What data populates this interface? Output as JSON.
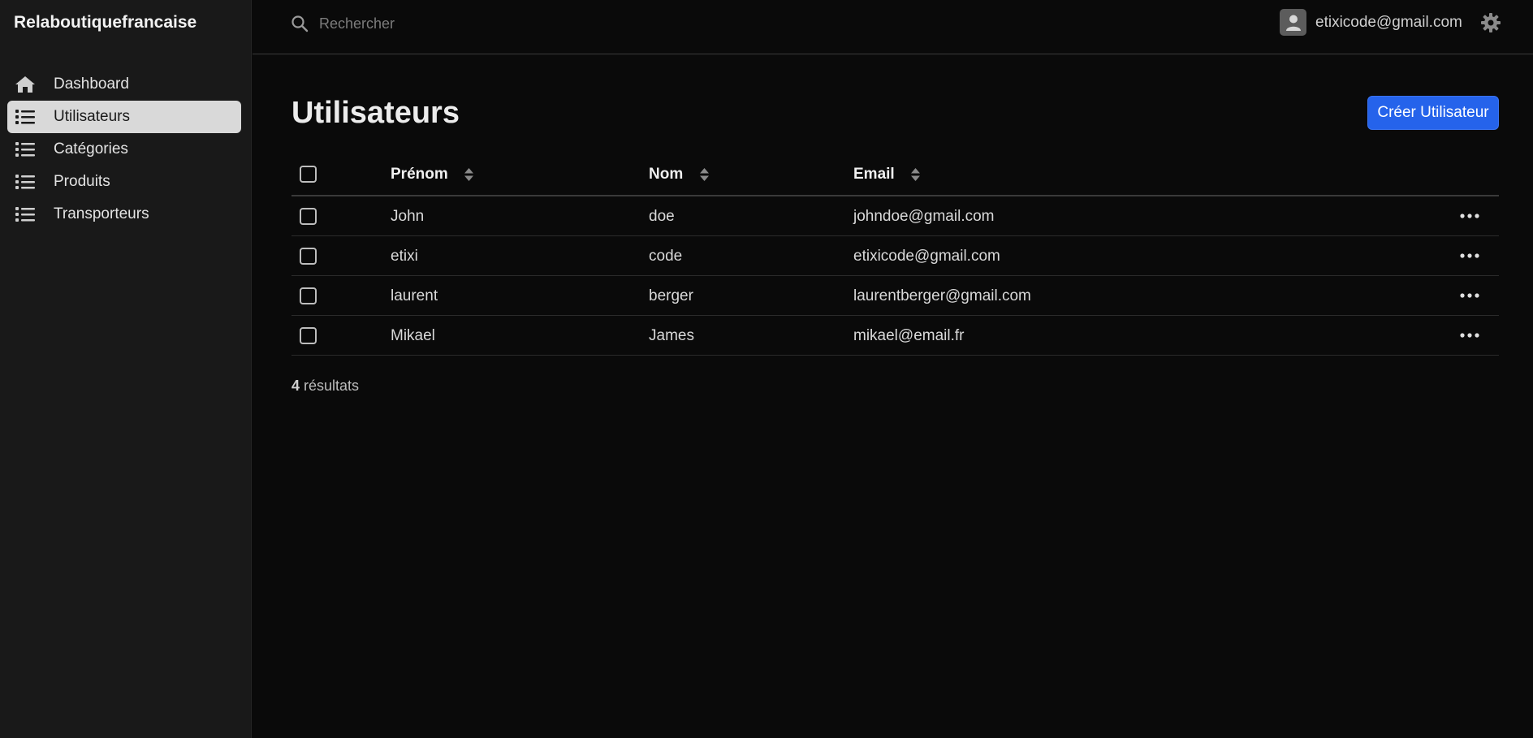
{
  "sidebar": {
    "brand": "Relaboutiquefrancaise",
    "items": [
      {
        "label": "Dashboard",
        "icon": "home-icon",
        "active": false
      },
      {
        "label": "Utilisateurs",
        "icon": "list-icon",
        "active": true
      },
      {
        "label": "Catégories",
        "icon": "list-icon",
        "active": false
      },
      {
        "label": "Produits",
        "icon": "list-icon",
        "active": false
      },
      {
        "label": "Transporteurs",
        "icon": "list-icon",
        "active": false
      }
    ]
  },
  "topbar": {
    "search": {
      "placeholder": "Rechercher",
      "value": ""
    },
    "user_email": "etixicode@gmail.com",
    "icons": [
      "search-icon",
      "avatar-icon",
      "gear-icon"
    ]
  },
  "main": {
    "title": "Utilisateurs",
    "create_button": "Créer Utilisateur",
    "table": {
      "columns": [
        "Prénom",
        "Nom",
        "Email"
      ],
      "rows": [
        {
          "first": "John",
          "last": "doe",
          "email": "johndoe@gmail.com"
        },
        {
          "first": "etixi",
          "last": "code",
          "email": "etixicode@gmail.com"
        },
        {
          "first": "laurent",
          "last": "berger",
          "email": "laurentberger@gmail.com"
        },
        {
          "first": "Mikael",
          "last": "James",
          "email": "mikael@email.fr"
        }
      ]
    },
    "results": {
      "count": "4",
      "label": "résultats"
    }
  },
  "colors": {
    "background": "#0a0a0a",
    "sidebar": "#191919",
    "accent": "#2563eb",
    "active_item": "#d9d9d9"
  }
}
